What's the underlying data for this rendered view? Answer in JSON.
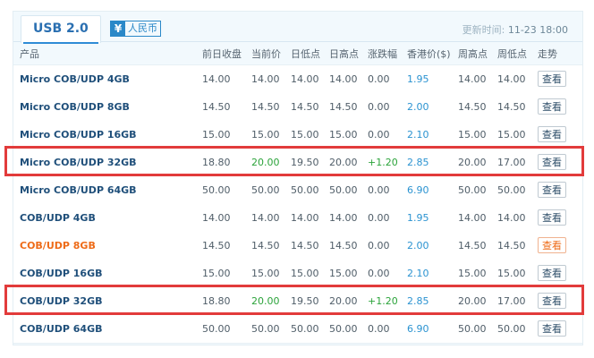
{
  "tab": {
    "label": "USB 2.0"
  },
  "currency": {
    "symbol": "¥",
    "label": "人民币"
  },
  "update": {
    "label": "更新时间:",
    "timestamp": "11-23 18:00"
  },
  "columns": [
    "产品",
    "前日收盘",
    "当前价",
    "日低点",
    "日高点",
    "涨跌幅",
    "香港价($)",
    "周高点",
    "周低点",
    "走势"
  ],
  "rows": [
    {
      "name": "Micro COB/UDP 4GB",
      "prev_close": "14.00",
      "current": "14.00",
      "day_low": "14.00",
      "day_high": "14.00",
      "change": "0.00",
      "hk_price": "1.95",
      "week_high": "14.00",
      "week_low": "14.00",
      "action": "查看"
    },
    {
      "name": "Micro COB/UDP 8GB",
      "prev_close": "14.50",
      "current": "14.50",
      "day_low": "14.50",
      "day_high": "14.50",
      "change": "0.00",
      "hk_price": "2.00",
      "week_high": "14.50",
      "week_low": "14.50",
      "action": "查看"
    },
    {
      "name": "Micro COB/UDP 16GB",
      "prev_close": "15.00",
      "current": "15.00",
      "day_low": "15.00",
      "day_high": "15.00",
      "change": "0.00",
      "hk_price": "2.10",
      "week_high": "15.00",
      "week_low": "15.00",
      "action": "查看"
    },
    {
      "name": "Micro COB/UDP 32GB",
      "prev_close": "18.80",
      "current": "20.00",
      "day_low": "19.50",
      "day_high": "20.00",
      "change": "+1.20",
      "hk_price": "2.85",
      "week_high": "20.00",
      "week_low": "17.00",
      "action": "查看"
    },
    {
      "name": "Micro COB/UDP 64GB",
      "prev_close": "50.00",
      "current": "50.00",
      "day_low": "50.00",
      "day_high": "50.00",
      "change": "0.00",
      "hk_price": "6.90",
      "week_high": "50.00",
      "week_low": "50.00",
      "action": "查看"
    },
    {
      "name": "COB/UDP 4GB",
      "prev_close": "14.00",
      "current": "14.00",
      "day_low": "14.00",
      "day_high": "14.00",
      "change": "0.00",
      "hk_price": "1.95",
      "week_high": "14.00",
      "week_low": "14.00",
      "action": "查看"
    },
    {
      "name": "COB/UDP 8GB",
      "prev_close": "14.50",
      "current": "14.50",
      "day_low": "14.50",
      "day_high": "14.50",
      "change": "0.00",
      "hk_price": "2.00",
      "week_high": "14.50",
      "week_low": "14.50",
      "action": "查看"
    },
    {
      "name": "COB/UDP 16GB",
      "prev_close": "15.00",
      "current": "15.00",
      "day_low": "15.00",
      "day_high": "15.00",
      "change": "0.00",
      "hk_price": "2.10",
      "week_high": "15.00",
      "week_low": "15.00",
      "action": "查看"
    },
    {
      "name": "COB/UDP 32GB",
      "prev_close": "18.80",
      "current": "20.00",
      "day_low": "19.50",
      "day_high": "20.00",
      "change": "+1.20",
      "hk_price": "2.85",
      "week_high": "20.00",
      "week_low": "17.00",
      "action": "查看"
    },
    {
      "name": "COB/UDP 64GB",
      "prev_close": "50.00",
      "current": "50.00",
      "day_low": "50.00",
      "day_high": "50.00",
      "change": "0.00",
      "hk_price": "6.90",
      "week_high": "50.00",
      "week_low": "50.00",
      "action": "查看"
    }
  ],
  "colors": {
    "accent": "#2a6fb1",
    "up": "#2ba33a",
    "hk_price": "#2b93d1",
    "hover_orange": "#ee6b18",
    "highlight_box": "#e23b3b"
  }
}
